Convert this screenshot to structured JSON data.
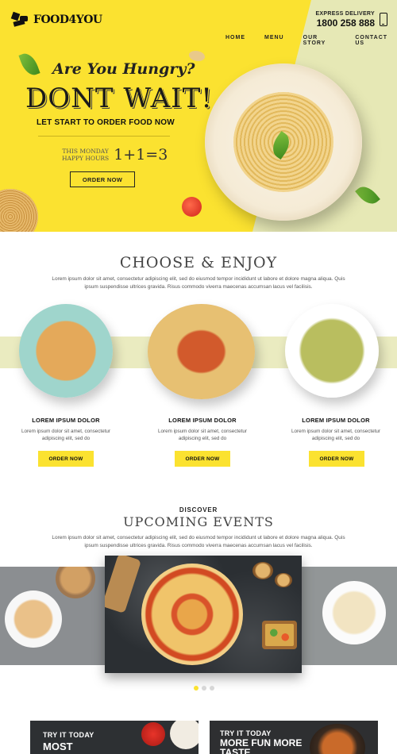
{
  "brand": {
    "name": "FOOD4YOU"
  },
  "header": {
    "delivery_label": "EXPRESS DELIVERY",
    "phone": "1800 258 888",
    "nav": [
      "HOME",
      "MENU",
      "OUR STORY",
      "CONTACT US"
    ]
  },
  "hero": {
    "tagline": "Are You Hungry?",
    "title": "DONT WAIT!",
    "subtitle": "LET START TO ORDER FOOD NOW",
    "happy_line1": "THIS MONDAY",
    "happy_line2": "HAPPY HOURS",
    "offer": "1+1=3",
    "cta": "ORDER NOW"
  },
  "choose": {
    "title": "CHOOSE & ENJOY",
    "description": "Lorem ipsum dolor sit amet, consectetur adipiscing elit, sed do eiusmod tempor incididunt ut labore et dolore magna aliqua. Quis ipsum suspendisse ultrices gravida. Risus commodo viverra maecenas accumsan lacus vel facilisis.",
    "cards": [
      {
        "title": "LOREM IPSUM DOLOR",
        "text": "Lorem ipsum dolor sit amet, consectetur adipiscing elit, sed do",
        "cta": "ORDER NOW"
      },
      {
        "title": "LOREM IPSUM DOLOR",
        "text": "Lorem ipsum dolor sit amet, consectetur adipiscing elit, sed do",
        "cta": "ORDER NOW"
      },
      {
        "title": "LOREM IPSUM DOLOR",
        "text": "Lorem ipsum dolor sit amet, consectetur adipiscing elit, sed do",
        "cta": "ORDER NOW"
      }
    ]
  },
  "events": {
    "kicker": "DISCOVER",
    "title": "UPCOMING EVENTS",
    "description": "Lorem ipsum dolor sit amet, consectetur adipiscing elit, sed do eiusmod tempor incididunt ut labore et dolore magna aliqua. Quis ipsum suspendisse ultrices gravida. Risus commodo viverra maecenas accumsan lacus vel facilisis.",
    "slider_active_index": 0,
    "slider_count": 3
  },
  "promos": [
    {
      "kicker": "TRY IT TODAY",
      "headline": "MOST"
    },
    {
      "kicker": "TRY IT TODAY",
      "headline": "MORE FUN MORE TASTE"
    }
  ],
  "colors": {
    "accent": "#fbe230",
    "band": "#eaebc0",
    "hero_right": "#e6e8b5",
    "text_dark": "#111111"
  },
  "icons": [
    "logo-mark-icon",
    "phone-icon",
    "leaf-icon",
    "tomato-icon"
  ]
}
